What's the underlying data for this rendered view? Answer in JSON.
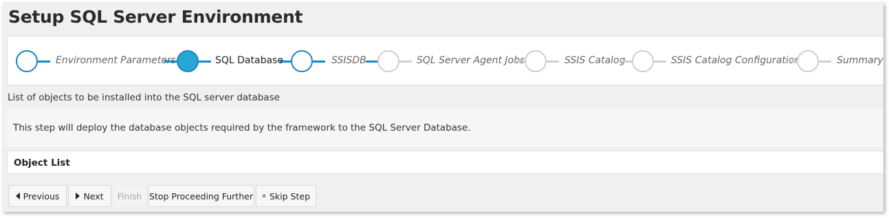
{
  "page": {
    "title": "Setup SQL Server Environment",
    "subtitle": "List of objects to be installed into the SQL server database",
    "description": "This step will deploy the database objects required by the framework to the SQL Server Database.",
    "object_list_title": "Object List"
  },
  "stepper": {
    "steps": [
      {
        "label": "Environment Parameters",
        "state": "done"
      },
      {
        "label": "SQL Database",
        "state": "active"
      },
      {
        "label": "SSISDB",
        "state": "done"
      },
      {
        "label": "SQL Server Agent Jobs",
        "state": "pending"
      },
      {
        "label": "SSIS Catalog",
        "state": "pending"
      },
      {
        "label": "SSIS Catalog Configuration",
        "state": "pending"
      },
      {
        "label": "Summary",
        "state": "pending"
      }
    ]
  },
  "buttons": {
    "previous": "Previous",
    "next": "Next",
    "finish": "Finish",
    "stop": "Stop Proceeding Further",
    "skip": "Skip Step"
  },
  "colors": {
    "accent": "#1a85c4",
    "active_fill": "#26a7d6",
    "pending": "#cfcfcf"
  }
}
